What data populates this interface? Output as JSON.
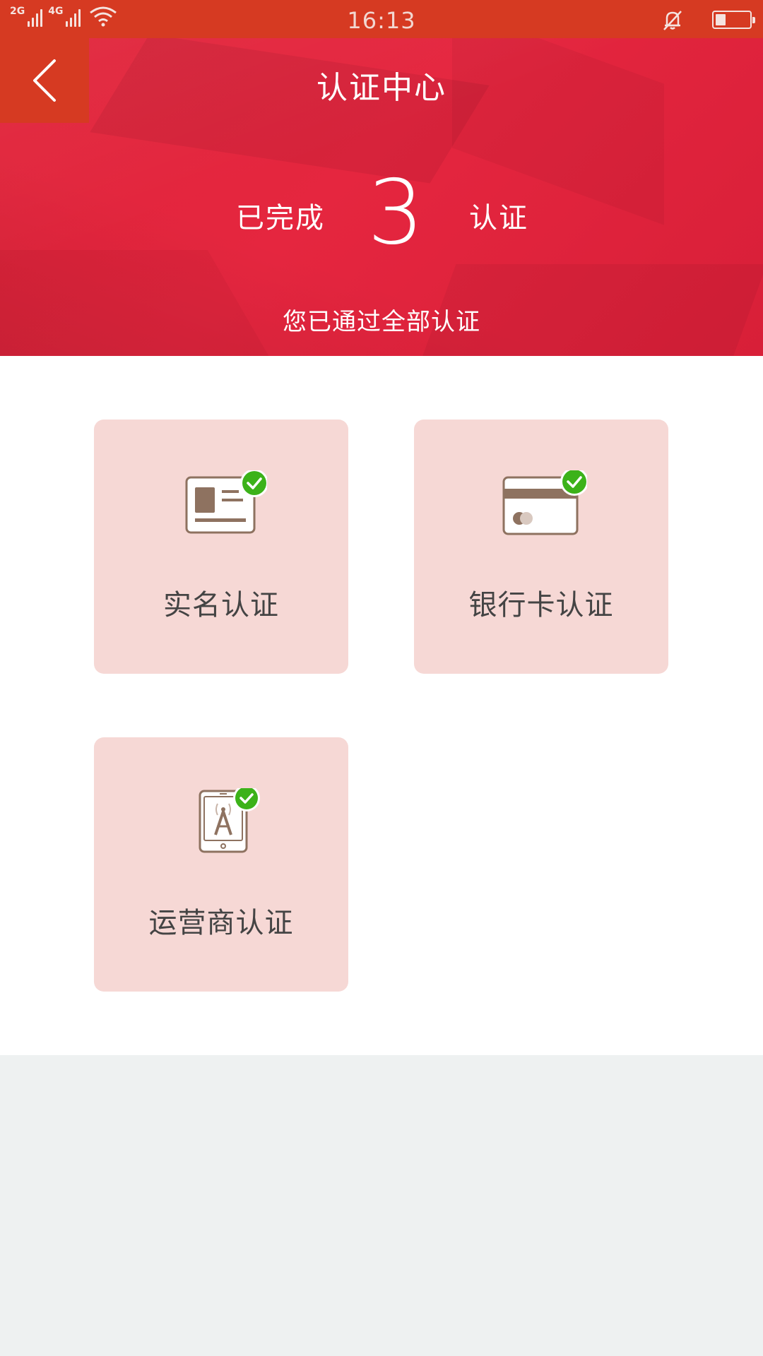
{
  "status_bar": {
    "network1": "2G",
    "network2": "4G",
    "time": "16:13",
    "battery_level": 0.3,
    "icons": [
      "signal-icon",
      "wifi-icon",
      "alarm-off-icon",
      "battery-icon"
    ]
  },
  "header": {
    "title": "认证中心",
    "back_icon": "chevron-left-icon"
  },
  "summary": {
    "prefix": "已完成",
    "count": "3",
    "suffix": "认证",
    "subtitle": "您已通过全部认证"
  },
  "cards": [
    {
      "label": "实名认证",
      "icon": "id-card-icon",
      "verified": true
    },
    {
      "label": "银行卡认证",
      "icon": "bank-card-icon",
      "verified": true
    },
    {
      "label": "运营商认证",
      "icon": "carrier-tower-icon",
      "verified": true
    }
  ],
  "colors": {
    "status_bar": "#d63a22",
    "hero": "#e0243a",
    "card_bg": "#f6d8d5",
    "icon_brown": "#8e7260",
    "check_green": "#3cb219"
  }
}
